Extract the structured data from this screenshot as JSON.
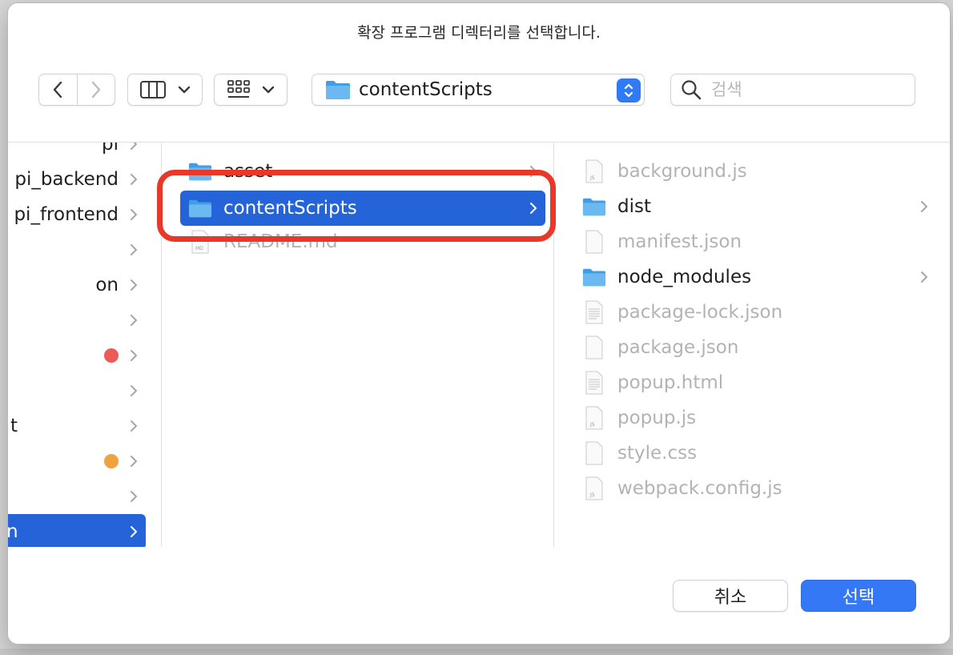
{
  "dialog": {
    "title": "확장 프로그램 디렉터리를 선택합니다."
  },
  "toolbar": {
    "path_label": "contentScripts",
    "search_placeholder": "검색",
    "back_icon": "chevron-left-icon",
    "forward_icon": "chevron-right-icon",
    "view_icon": "columns-icon",
    "group_icon": "grid-icon",
    "accent_color": "#2f7bf5"
  },
  "sidebar": {
    "items": [
      {
        "label": "pi",
        "tag_color": null
      },
      {
        "label": "pi_backend",
        "tag_color": null
      },
      {
        "label": "pi_frontend",
        "tag_color": null
      },
      {
        "label": "",
        "tag_color": null
      },
      {
        "label": "on",
        "tag_color": null
      },
      {
        "label": "",
        "tag_color": null
      },
      {
        "label": "",
        "tag_color": "#ec5b55"
      },
      {
        "label": "",
        "tag_color": null
      },
      {
        "label": "t",
        "tag_color": null
      },
      {
        "label": "",
        "tag_color": "#f0a140"
      },
      {
        "label": "",
        "tag_color": null
      },
      {
        "label": "n",
        "tag_color": null,
        "selected": true
      }
    ]
  },
  "middle": {
    "items": [
      {
        "name": "asset",
        "kind": "folder",
        "has_children": true
      },
      {
        "name": "contentScripts",
        "kind": "folder",
        "has_children": true,
        "selected": true
      },
      {
        "name": "README.md",
        "kind": "md-file",
        "dim": true
      }
    ]
  },
  "contents": {
    "items": [
      {
        "name": "background.js",
        "kind": "js-file",
        "dim": true
      },
      {
        "name": "dist",
        "kind": "folder",
        "has_children": true
      },
      {
        "name": "manifest.json",
        "kind": "file",
        "dim": true
      },
      {
        "name": "node_modules",
        "kind": "folder",
        "has_children": true
      },
      {
        "name": "package-lock.json",
        "kind": "text-file",
        "dim": true
      },
      {
        "name": "package.json",
        "kind": "file",
        "dim": true
      },
      {
        "name": "popup.html",
        "kind": "text-file",
        "dim": true
      },
      {
        "name": "popup.js",
        "kind": "js-file",
        "dim": true
      },
      {
        "name": "style.css",
        "kind": "file",
        "dim": true
      },
      {
        "name": "webpack.config.js",
        "kind": "js-file",
        "dim": true
      }
    ]
  },
  "footer": {
    "cancel_label": "취소",
    "choose_label": "선택"
  },
  "annotation": {
    "highlight_color": "#e8382a"
  }
}
